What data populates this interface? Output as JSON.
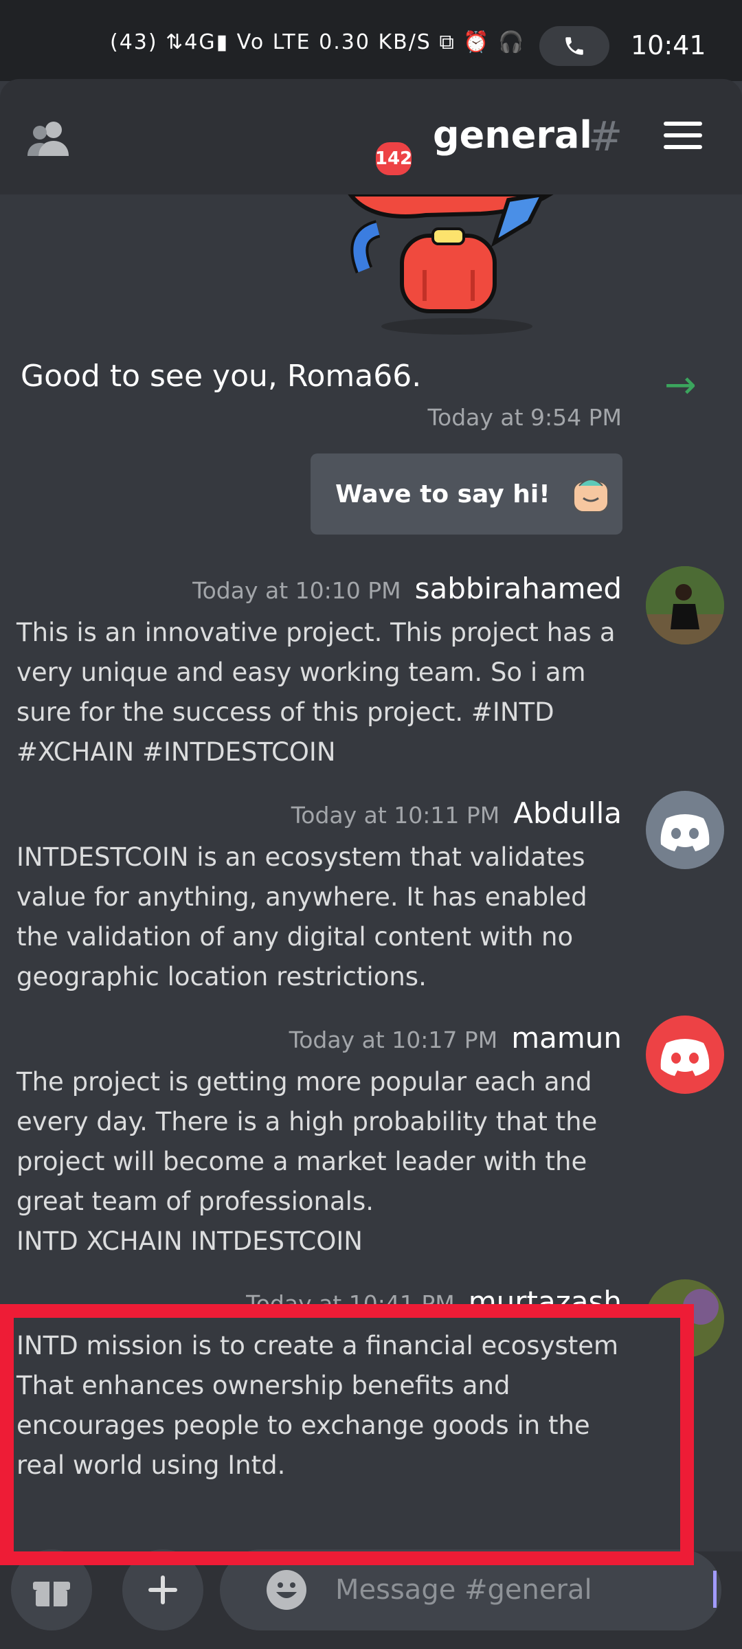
{
  "status_bar": {
    "time": "10:41",
    "icons_text": "(43) ⇅4G▮ Vo LTE 0.30 KB/S ⧉ ⏰ 🎧"
  },
  "header": {
    "channel": "general",
    "badge": "142"
  },
  "welcome": {
    "text": "Good to see you, Roma66.",
    "timestamp": "Today at 9:54 PM",
    "wave_label": "Wave to say hi!"
  },
  "messages": [
    {
      "user": "sabbirahamed",
      "timestamp": "Today at 10:10 PM",
      "text": "This is an innovative project. This project has a very unique and easy working team. So i am sure for the success of this project. #INTD #XCHAIN #INTDESTCOIN",
      "avatar": "photo"
    },
    {
      "user": "Abdulla",
      "timestamp": "Today at 10:11 PM",
      "text": "INTDESTCOIN is an ecosystem that validates value for anything, anywhere. It has enabled the validation of any digital content with no geographic location restrictions.",
      "avatar_color": "#747f8d"
    },
    {
      "user": "mamun",
      "timestamp": "Today at 10:17 PM",
      "text": "The project is getting more popular each and every day. There is a high probability that the project will become a market leader with the great team of professionals.\nINTD XCHAIN  INTDESTCOIN",
      "avatar_color": "#ed4245"
    },
    {
      "user": "murtazash",
      "timestamp": "Today at 10:41 PM",
      "text": "INTD mission is to create a financial ecosystem That enhances ownership benefits and encourages people to exchange goods in the real world using Intd.",
      "avatar": "photo"
    }
  ],
  "input": {
    "placeholder": "Message #general"
  },
  "colors": {
    "accent": "#5865f2",
    "highlight": "#ee1c36",
    "online_arrow": "#3ba55d"
  }
}
